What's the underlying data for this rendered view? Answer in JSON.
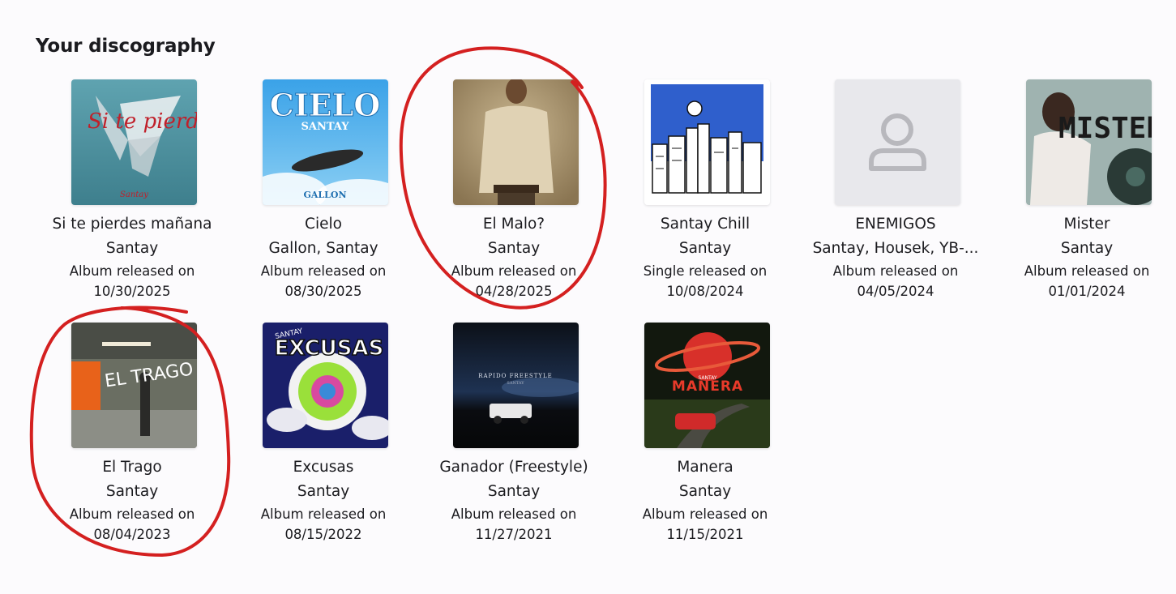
{
  "page": {
    "title": "Your discography"
  },
  "annotation_color": "#d42020",
  "albums": [
    {
      "name": "Si te pierdes mañana",
      "artist": "Santay",
      "release_label": "Album released on",
      "date": "10/30/2025",
      "art_text": "Si te pierdes mañana",
      "art_small": "Santay"
    },
    {
      "name": "Cielo",
      "artist": "Gallon, Santay",
      "release_label": "Album released on",
      "date": "08/30/2025",
      "art_text": "CIELO",
      "art_small": "SANTAY",
      "art_small2": "GALLON"
    },
    {
      "name": "El Malo?",
      "artist": "Santay",
      "release_label": "Album released on",
      "date": "04/28/2025"
    },
    {
      "name": "Santay Chill",
      "artist": "Santay",
      "release_label": "Single released on",
      "date": "10/08/2024"
    },
    {
      "name": "ENEMIGOS",
      "artist": "Santay, Housek, YB-...",
      "release_label": "Album released on",
      "date": "04/05/2024",
      "placeholder_icon": "person-placeholder-icon"
    },
    {
      "name": "Mister",
      "artist": "Santay",
      "release_label": "Album released on",
      "date": "01/01/2024",
      "art_text": "MISTER"
    },
    {
      "name": "El Trago",
      "artist": "Santay",
      "release_label": "Album released on",
      "date": "08/04/2023",
      "art_text": "EL TRAGO"
    },
    {
      "name": "Excusas",
      "artist": "Santay",
      "release_label": "Album released on",
      "date": "08/15/2022",
      "art_text": "EXCUSAS",
      "art_small": "SANTAY"
    },
    {
      "name": "Ganador (Freestyle)",
      "artist": "Santay",
      "release_label": "Album released on",
      "date": "11/27/2021",
      "art_text": "RAPIDO FREESTYLE",
      "art_small": "SANTAY"
    },
    {
      "name": "Manera",
      "artist": "Santay",
      "release_label": "Album released on",
      "date": "11/15/2021",
      "art_text": "MANERA",
      "art_small": "SANTAY"
    }
  ]
}
